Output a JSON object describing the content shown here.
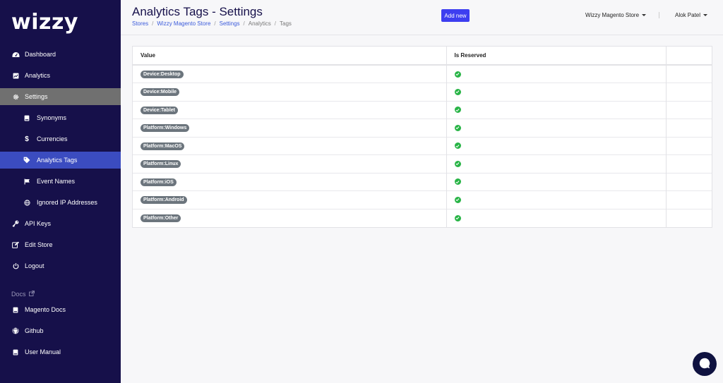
{
  "brand": {
    "logo_text": "wizzy"
  },
  "sidebar": {
    "items": [
      {
        "label": "Dashboard",
        "icon": "dashboard-icon"
      },
      {
        "label": "Analytics",
        "icon": "chart-icon"
      },
      {
        "label": "Settings",
        "icon": "gear-icon"
      },
      {
        "label": "Synonyms",
        "icon": "book-icon"
      },
      {
        "label": "Currencies",
        "icon": "dollar-icon"
      },
      {
        "label": "Analytics Tags",
        "icon": "tag-icon"
      },
      {
        "label": "Event Names",
        "icon": "flag-icon"
      },
      {
        "label": "Ignored IP Addresses",
        "icon": "globe-icon"
      },
      {
        "label": "API Keys",
        "icon": "key-icon"
      },
      {
        "label": "Edit Store",
        "icon": "edit-icon"
      },
      {
        "label": "Logout",
        "icon": "power-icon"
      }
    ],
    "docs_heading": "Docs",
    "docs_items": [
      {
        "label": "Magento Docs",
        "icon": "book-icon"
      },
      {
        "label": "Github",
        "icon": "github-icon"
      },
      {
        "label": "User Manual",
        "icon": "book-icon"
      }
    ]
  },
  "header": {
    "title": "Analytics Tags - Settings",
    "breadcrumb": [
      "Stores",
      "Wizzy Magento Store",
      "Settings",
      "Analytics",
      "Tags"
    ],
    "add_button": "Add new",
    "store_selector": "Wizzy Magento Store",
    "user_name": "Alok Patel"
  },
  "table": {
    "columns": [
      "Value",
      "Is Reserved",
      ""
    ],
    "rows": [
      {
        "value": "Device:Desktop",
        "reserved": true
      },
      {
        "value": "Device:Mobile",
        "reserved": true
      },
      {
        "value": "Device:Tablet",
        "reserved": true
      },
      {
        "value": "Platform:Windows",
        "reserved": true
      },
      {
        "value": "Platform:MacOS",
        "reserved": true
      },
      {
        "value": "Platform:Linux",
        "reserved": true
      },
      {
        "value": "Platform:iOS",
        "reserved": true
      },
      {
        "value": "Platform:Android",
        "reserved": true
      },
      {
        "value": "Platform:Other",
        "reserved": true
      }
    ]
  },
  "colors": {
    "sidebar_bg": "#16104a",
    "active_item": "#3b4cc0",
    "settings_item": "#707070",
    "primary_button": "#3d3ef0",
    "check": "#28b446",
    "pill": "#6c757d"
  }
}
